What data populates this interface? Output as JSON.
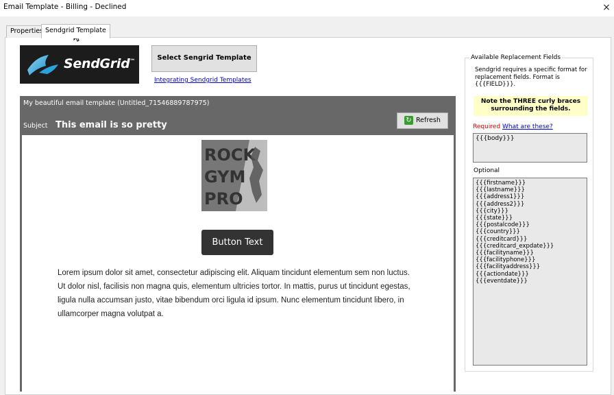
{
  "window": {
    "title": "Email Template - Billing - Declined",
    "close_label": "×"
  },
  "tabs": [
    {
      "label": "Properties",
      "active": false
    },
    {
      "label": "Sendgrid Template",
      "active": true
    }
  ],
  "sendgrid": {
    "logo_text": "SendGrid",
    "logo_tm": "™",
    "select_button": "Select Sengrid Template",
    "integrate_link": "Integrating Sendgrid Templates"
  },
  "editor": {
    "template_name": "My beautiful email template (Untitled_71546889787975)",
    "subject_label": "Subject",
    "subject_value": "This email is so pretty",
    "refresh_label": "Refresh",
    "logo_words": [
      "ROCK",
      "GYM",
      "PRO"
    ],
    "button_text": "Button Text",
    "body_text": "Lorem ipsum dolor sit amet, consectetur adipiscing elit. Aliquam tincidunt elementum sem non luctus. Ut dolor nisl, facilisis non magna quis, elementum ultricies tortor. In mattis, purus ut tincidunt egestas, ligula nulla accumsan justo, vitae bibendum orci ligula id ipsum. Nunc elementum tincidunt libero, in ullamcorper magna volutpat a."
  },
  "fields": {
    "legend": "Available Replacement Fields",
    "description": "Sendgrid requires a specific format for replacement fields.  Format is {{{FIELD}}}.",
    "note": "Note the THREE curly braces surrounding the fields.",
    "required_label": "Required",
    "what_link": "What are these?",
    "required_value": "{{{body}}}",
    "optional_label": "Optional",
    "optional": [
      "{{{firstname}}}",
      "{{{lastname}}}",
      "{{{address1}}}",
      "{{{address2}}}",
      "{{{city}}}",
      "{{{state}}}",
      "{{{postalcode}}}",
      "{{{country}}}",
      "{{{creditcard}}}",
      "{{{creditcard_expdate}}}",
      "{{{facilityname}}}",
      "{{{facilityphone}}}",
      "{{{facilityaddress}}}",
      "{{{actiondate}}}",
      "{{{eventdate}}}"
    ]
  },
  "colors": {
    "editor_header": "#686868",
    "link": "#0000cc",
    "required": "#e00000",
    "note_bg": "#ffffc8",
    "email_button": "#333333",
    "refresh_icon": "#3c9a32"
  }
}
